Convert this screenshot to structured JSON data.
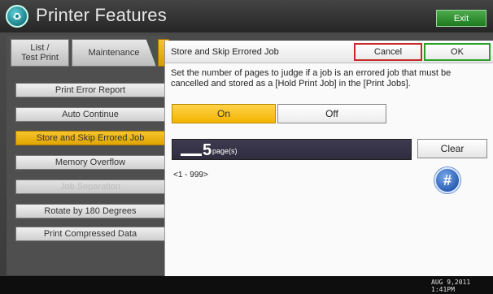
{
  "header": {
    "title": "Printer Features",
    "exit_label": "Exit",
    "icon": "printer-features-icon"
  },
  "tabs": [
    {
      "label_line1": "List /",
      "label_line2": "Test Print"
    },
    {
      "label": "Maintenance"
    }
  ],
  "menu": {
    "items": [
      {
        "label": "Print Error Report",
        "state": "normal"
      },
      {
        "label": "Auto Continue",
        "state": "normal"
      },
      {
        "label": "Store and Skip Errored Job",
        "state": "active"
      },
      {
        "label": "Memory Overflow",
        "state": "normal"
      },
      {
        "label": "Job Separation",
        "state": "disabled"
      },
      {
        "label": "Rotate by 180 Degrees",
        "state": "normal"
      },
      {
        "label": "Print Compressed Data",
        "state": "normal"
      }
    ]
  },
  "dialog": {
    "title": "Store and Skip Errored Job",
    "cancel_label": "Cancel",
    "ok_label": "OK",
    "description": "Set the number of pages to judge if a job is an errored job that must be cancelled and stored as a [Hold Print Job] in the [Print Jobs].",
    "on_label": "On",
    "off_label": "Off",
    "selected": "On",
    "page_value": "5",
    "page_unit": "page(s)",
    "clear_label": "Clear",
    "range": "<1 - 999>",
    "hash_label": "#"
  },
  "footer": {
    "date_line1": "AUG   9,2011",
    "date_line2": "1:41PM"
  },
  "colors": {
    "accent_yellow": "#f2b400",
    "ok_green": "#2aa02a",
    "cancel_red": "#c8282a",
    "field_dark": "#33314a"
  }
}
